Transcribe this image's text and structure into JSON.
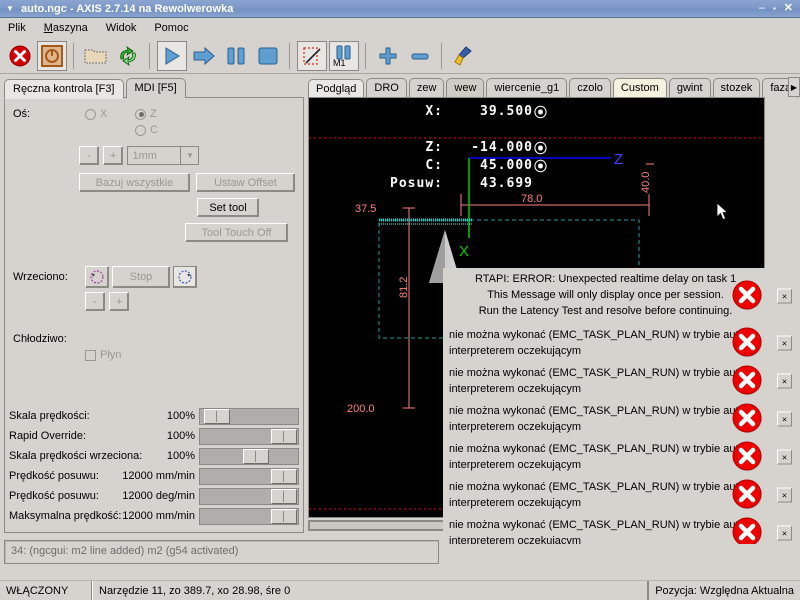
{
  "window": {
    "title": "auto.ngc - AXIS 2.7.14 na Rewolwerowka",
    "minimize_label": "Minimize",
    "maximize_label": "Maximize",
    "close_label": "Close"
  },
  "menubar": {
    "items": [
      {
        "label": "Plik",
        "underline": ""
      },
      {
        "label": "Maszyna",
        "underline": "M"
      },
      {
        "label": "Widok",
        "underline": ""
      },
      {
        "label": "Pomoc",
        "underline": ""
      }
    ]
  },
  "toolbar": {
    "items": [
      {
        "name": "estop-button",
        "title": "E-Stop",
        "icon": "red-x-circle-icon"
      },
      {
        "name": "machine-power-button",
        "title": "Machine Power",
        "icon": "power-icon",
        "pressed": true
      },
      {
        "name": "open-file-button",
        "title": "Open",
        "icon": "folder-icon"
      },
      {
        "name": "reload-file-button",
        "title": "Reload",
        "icon": "reload-icon"
      },
      {
        "name": "run-program-button",
        "title": "Run",
        "icon": "play-icon"
      },
      {
        "name": "step-button",
        "title": "Step",
        "icon": "arrow-right-icon"
      },
      {
        "name": "pause-button",
        "title": "Pause",
        "icon": "pause-icon"
      },
      {
        "name": "stop-button",
        "title": "Stop",
        "icon": "stop-square-icon"
      },
      {
        "name": "toggle-block-delete-button",
        "title": "Block Delete",
        "icon": "block-delete-icon"
      },
      {
        "name": "toggle-optional-stop-button",
        "title": "Optional Stop",
        "icon": "optional-stop-m1-icon"
      },
      {
        "name": "zoom-in-button",
        "title": "Zoom In",
        "icon": "plus-icon"
      },
      {
        "name": "zoom-out-button",
        "title": "Zoom Out",
        "icon": "minus-icon"
      },
      {
        "name": "clear-plot-button",
        "title": "Clear Plot",
        "icon": "broom-icon"
      }
    ]
  },
  "left_panel": {
    "tabs": [
      {
        "label": "Ręczna kontrola [F3]",
        "active": true
      },
      {
        "label": "MDI [F5]",
        "active": false
      }
    ],
    "axis_label": "Oś:",
    "axes": [
      {
        "label": "X",
        "selected": false
      },
      {
        "label": "Z",
        "selected": true
      },
      {
        "label": "C",
        "selected": false
      }
    ],
    "jog_minus": "-",
    "jog_plus": "+",
    "increment_value": "1mm",
    "home_all_label": "Bazuj wszystkie",
    "set_offset_label": "Ustaw Offset",
    "set_tool_label": "Set tool",
    "tool_touch_off_label": "Tool Touch Off",
    "spindle_label": "Wrzeciono:",
    "spindle_stop_label": "Stop",
    "spindle_ccw_icon": "spindle-ccw-icon",
    "spindle_cw_icon": "spindle-cw-icon",
    "spindle_minus": "-",
    "spindle_plus": "+",
    "coolant_label": "Chłodziwo:",
    "coolant_flood_label": "Płyn",
    "sliders": [
      {
        "name": "Skala prędkości:",
        "value": "100%",
        "pos_pct": 6
      },
      {
        "name": "Rapid Override:",
        "value": "100%",
        "pos_pct": 100
      },
      {
        "name": "Skala prędkości wrzeciona:",
        "value": "100%",
        "pos_pct": 48
      },
      {
        "name": "Prędkość posuwu:",
        "value": "12000 mm/min",
        "pos_pct": 100
      },
      {
        "name": "Prędkość posuwu:",
        "value": "12000 deg/min",
        "pos_pct": 100
      },
      {
        "name": "Maksymalna prędkość:",
        "value": "12000 mm/min",
        "pos_pct": 100
      }
    ]
  },
  "right_panel": {
    "tabs": [
      {
        "label": "Podgląd",
        "style": "active"
      },
      {
        "label": "DRO",
        "style": "normal"
      },
      {
        "label": "zew",
        "style": "normal"
      },
      {
        "label": "wew",
        "style": "shade"
      },
      {
        "label": "wiercenie_g1",
        "style": "normal"
      },
      {
        "label": "czolo",
        "style": "normal"
      },
      {
        "label": "Custom",
        "style": "cream"
      },
      {
        "label": "gwint",
        "style": "normal"
      },
      {
        "label": "stozek",
        "style": "normal"
      },
      {
        "label": "faza_w",
        "style": "normal"
      }
    ],
    "tab_scroll_icon": "chevron-right-icon"
  },
  "dro": {
    "rows": [
      {
        "label": "X:",
        "value": "39.500",
        "home_icon": "home-marker-icon"
      },
      {
        "label": "Z:",
        "value": "-14.000",
        "home_icon": "home-marker-icon"
      },
      {
        "label": "C:",
        "value": "45.000",
        "home_icon": "home-marker-icon"
      },
      {
        "label": "Posuw:",
        "value": "43.699",
        "home_icon": ""
      }
    ]
  },
  "plot": {
    "axis_z_label": "Z",
    "axis_x_label": "X",
    "dim_top": "78.0",
    "dim_right": "40.0",
    "dim_left_upper": "37.5",
    "dim_left_mid": "81.2",
    "dim_left_lower": "200.0",
    "colors": {
      "background": "#000000",
      "dimension": "#ff8080",
      "z_axis": "#0000ff",
      "x_axis": "#00ff00",
      "tool_path": "#00cccc",
      "limit": "#ff0000"
    }
  },
  "errors": [
    {
      "lines": [
        "RTAPI: ERROR: Unexpected realtime delay on task 1",
        "This Message will only display once per session.",
        "Run the Latency Test and resolve before continuing."
      ],
      "align": "center",
      "icon": "error-x-icon",
      "close_label": "×"
    },
    {
      "lines": [
        "nie można wykonać (EMC_TASK_PLAN_RUN) w trybie auto i",
        "interpreterem oczekującym"
      ],
      "align": "left",
      "icon": "error-x-icon",
      "close_label": "×"
    },
    {
      "lines": [
        "nie można wykonać (EMC_TASK_PLAN_RUN) w trybie auto i",
        "interpreterem oczekującym"
      ],
      "align": "left",
      "icon": "error-x-icon",
      "close_label": "×"
    },
    {
      "lines": [
        "nie można wykonać (EMC_TASK_PLAN_RUN) w trybie auto i",
        "interpreterem oczekującym"
      ],
      "align": "left",
      "icon": "error-x-icon",
      "close_label": "×"
    },
    {
      "lines": [
        "nie można wykonać (EMC_TASK_PLAN_RUN) w trybie auto i",
        "interpreterem oczekującym"
      ],
      "align": "left",
      "icon": "error-x-icon",
      "close_label": "×"
    },
    {
      "lines": [
        "nie można wykonać (EMC_TASK_PLAN_RUN) w trybie auto i",
        "interpreterem oczekującym"
      ],
      "align": "left",
      "icon": "error-x-icon",
      "close_label": "×"
    },
    {
      "lines": [
        "nie można wykonać (EMC_TASK_PLAN_RUN) w trybie auto i",
        "interpreterem oczekującym"
      ],
      "align": "left",
      "icon": "error-x-icon",
      "close_label": "×"
    }
  ],
  "gcode": {
    "current_line": "34: (ngcgui: m2 line added) m2 (g54 activated)"
  },
  "statusbar": {
    "machine_state": "WŁĄCZONY",
    "tool_info": "Narzędzie 11, zo 389.7, xo 28.98, śre 0",
    "position_mode": "Pozycja: Względna Aktualna"
  }
}
